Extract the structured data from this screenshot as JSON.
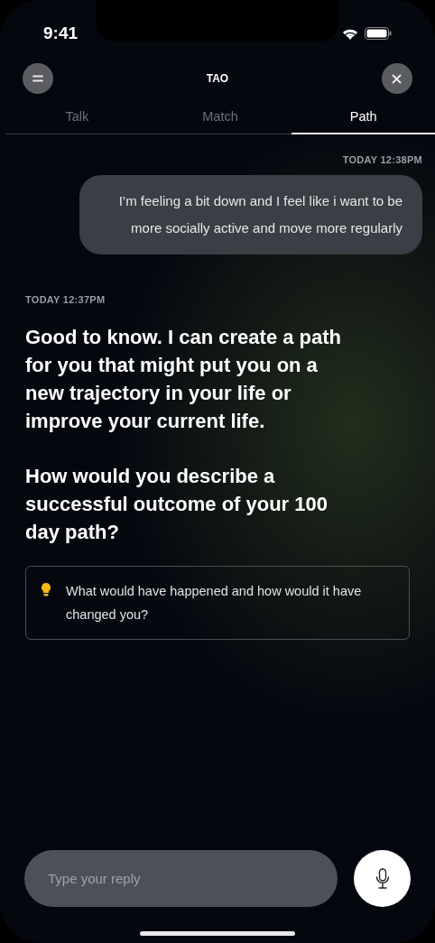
{
  "status_bar": {
    "time": "9:41"
  },
  "header": {
    "title": "TAO"
  },
  "tabs": [
    {
      "label": "Talk",
      "selected": false
    },
    {
      "label": "Match",
      "selected": false
    },
    {
      "label": "Path",
      "selected": true
    }
  ],
  "messages": [
    {
      "kind": "user",
      "time": "TODAY 12:38PM",
      "text": "I’m feeling a bit down and I feel like i want to be more socially active and move more regularly"
    },
    {
      "kind": "assistant",
      "time": "TODAY 12:37PM",
      "paragraphs": [
        "Good to know. I can create a path for you that might put you on a new trajectory in your life or improve your current life.",
        "How would you describe a successful outcome of your 100 day path?"
      ],
      "hint": "What would have happened and how would it have changed you?"
    }
  ],
  "composer": {
    "placeholder": "Type your reply"
  }
}
